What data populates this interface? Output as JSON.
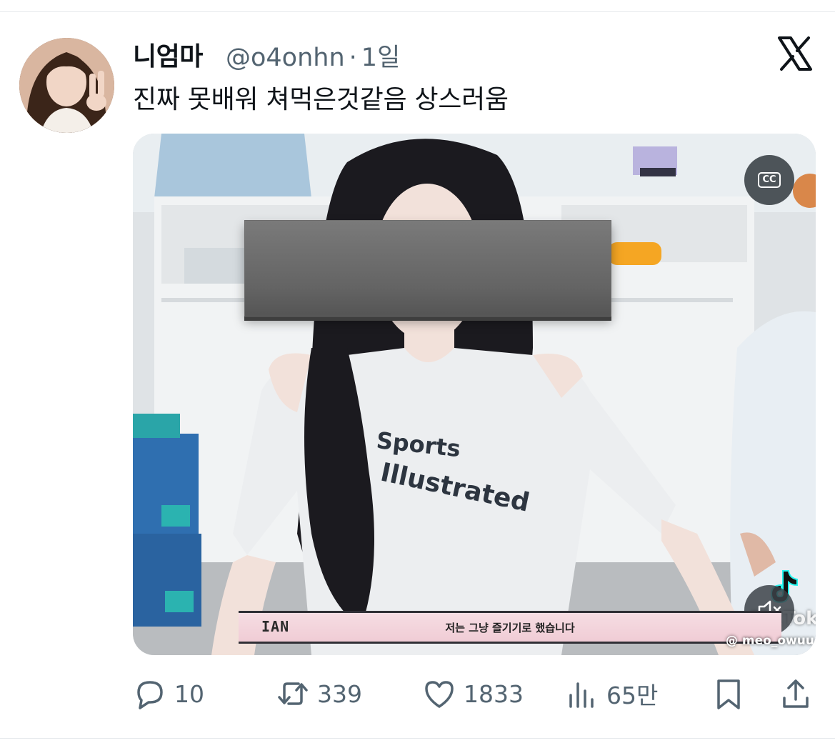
{
  "tweet": {
    "display_name": "니엄마",
    "handle": "@o4onhn",
    "separator": "·",
    "time_ago": "1일",
    "text": "진짜 못배워 쳐먹은것같음 상스러움",
    "logo": "x-logo-icon"
  },
  "media": {
    "cc_label": "CC",
    "subtitle_speaker": "IAN",
    "subtitle_text": "저는 그냥 즐기기로 했습니다",
    "shirt_text_1": "Sports",
    "shirt_text_2": "Illustrated",
    "watermark_word": "TikTok",
    "watermark_user": "@ meo_owuu",
    "mute_icon": "speaker-muted-icon"
  },
  "actions": {
    "reply_count": "10",
    "retweet_count": "339",
    "like_count": "1833",
    "views_count": "65만"
  },
  "colors": {
    "text_primary": "#0f1419",
    "text_secondary": "#536471"
  }
}
